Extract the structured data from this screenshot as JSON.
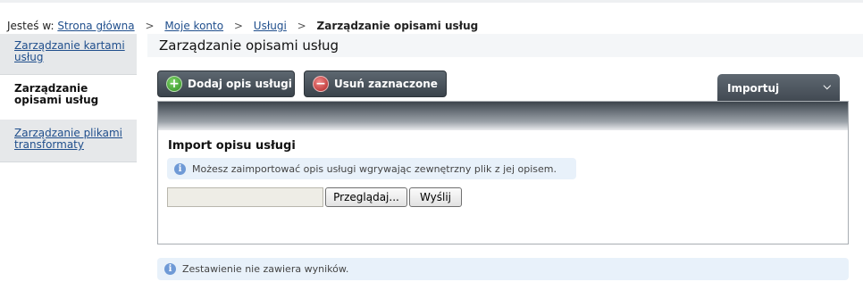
{
  "breadcrumb": {
    "prefix": "Jesteś w:",
    "items": [
      "Strona główna",
      "Moje konto",
      "Usługi"
    ],
    "separator": ">",
    "current": "Zarządzanie opisami usług"
  },
  "sidebar": {
    "items": [
      {
        "label": "Zarządzanie kartami usług",
        "active": false
      },
      {
        "label": "Zarządzanie opisami usług",
        "active": true
      },
      {
        "label": "Zarządzanie plikami transformaty",
        "active": false
      }
    ]
  },
  "page_title": "Zarządzanie opisami usług",
  "toolbar": {
    "add_label": "Dodaj opis usługi",
    "delete_label": "Usuń zaznaczone",
    "import_label": "Importuj",
    "add_icon": "plus-circle-icon",
    "delete_icon": "minus-circle-icon"
  },
  "import_panel": {
    "heading": "Import opisu usługi",
    "info": "Możesz zaimportować opis usługi wgrywając zewnętrzny plik z jej opisem.",
    "file_value": "",
    "browse_label": "Przeglądaj...",
    "send_label": "Wyślij"
  },
  "results_info": "Zestawienie nie zawiera wyników.",
  "colors": {
    "link": "#1f4e8c",
    "dark_button": "#3a434b",
    "info_bg": "#e8f1fa",
    "info_icon": "#6f9ad6",
    "sidebar_inactive": "#e6e8ea"
  }
}
